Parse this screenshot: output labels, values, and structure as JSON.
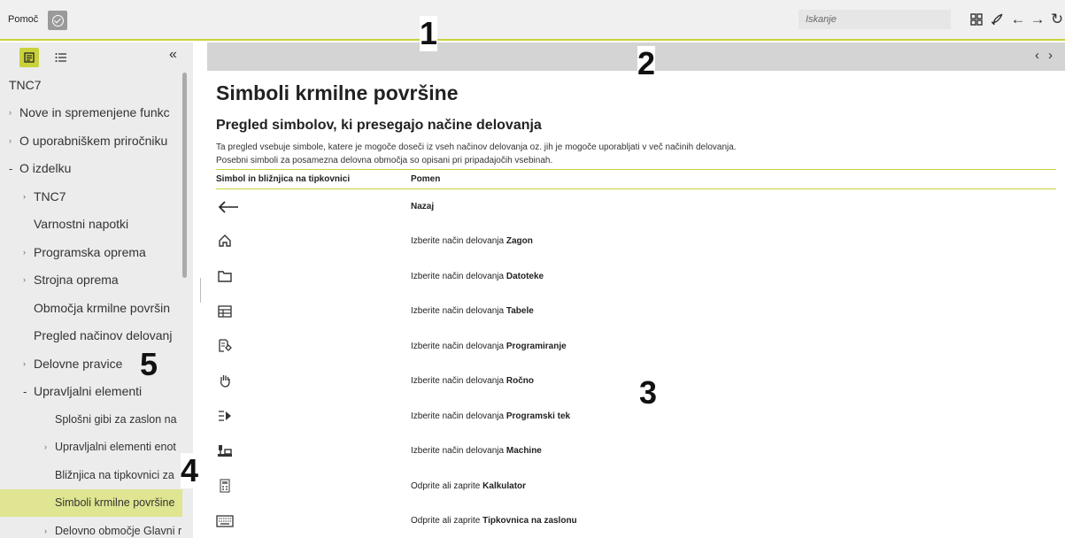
{
  "topbar": {
    "app_title": "Pomoč",
    "search_placeholder": "Iskanje"
  },
  "callouts": [
    "1",
    "2",
    "3",
    "4",
    "5"
  ],
  "sidebar": {
    "items": [
      {
        "label": "TNC7",
        "level": 0,
        "marker": ""
      },
      {
        "label": "Nove in spremenjene funkc",
        "level": 0,
        "marker": "arrow"
      },
      {
        "label": "O uporabniškem priročniku",
        "level": 0,
        "marker": "arrow"
      },
      {
        "label": "O izdelku",
        "level": 0,
        "marker": "minus"
      },
      {
        "label": "TNC7",
        "level": 1,
        "marker": "arrow"
      },
      {
        "label": "Varnostni napotki",
        "level": 1,
        "marker": ""
      },
      {
        "label": "Programska oprema",
        "level": 1,
        "marker": "arrow"
      },
      {
        "label": "Strojna oprema",
        "level": 1,
        "marker": "arrow"
      },
      {
        "label": "Območja krmilne površin",
        "level": 1,
        "marker": ""
      },
      {
        "label": "Pregled načinov delovanj",
        "level": 1,
        "marker": ""
      },
      {
        "label": "Delovne pravice",
        "level": 1,
        "marker": "arrow"
      },
      {
        "label": "Upravljalni elementi",
        "level": 1,
        "marker": "minus"
      },
      {
        "label": "Splošni gibi za zaslon na",
        "level": 2,
        "marker": ""
      },
      {
        "label": "Upravljalni elementi enot",
        "level": 2,
        "marker": "arrow"
      },
      {
        "label": "Bližnjica na tipkovnici za",
        "level": 2,
        "marker": ""
      },
      {
        "label": "Simboli krmilne površine",
        "level": 2,
        "marker": "",
        "active": true
      },
      {
        "label": "Delovno območje Glavni r",
        "level": 2,
        "marker": "arrow"
      }
    ]
  },
  "content": {
    "title": "Simboli krmilne površine",
    "subtitle": "Pregled simbolov, ki presegajo načine delovanja",
    "intro_line1": "Ta pregled vsebuje simbole, katere je mogoče doseči iz vseh načinov delovanja oz. jih je mogoče uporabljati v več načinih delovanja.",
    "intro_line2": "Posebni simboli za posamezna delovna območja so opisani pri pripadajočih vsebinah.",
    "table": {
      "headers": [
        "Simbol in bližnjica na tipkovnici",
        "Pomen"
      ],
      "rows": [
        {
          "icon": "back-arrow-icon",
          "prefix": "",
          "bold": "Nazaj"
        },
        {
          "icon": "home-icon",
          "prefix": "Izberite način delovanja ",
          "bold": "Zagon"
        },
        {
          "icon": "folder-icon",
          "prefix": "Izberite način delovanja ",
          "bold": "Datoteke"
        },
        {
          "icon": "table-icon",
          "prefix": "Izberite način delovanja ",
          "bold": "Tabele"
        },
        {
          "icon": "program-edit-icon",
          "prefix": "Izberite način delovanja ",
          "bold": "Programiranje"
        },
        {
          "icon": "hand-icon",
          "prefix": "Izberite način delovanja ",
          "bold": "Ročno"
        },
        {
          "icon": "program-run-icon",
          "prefix": "Izberite način delovanja ",
          "bold": "Programski tek"
        },
        {
          "icon": "machine-icon",
          "prefix": "Izberite način delovanja ",
          "bold": "Machine"
        },
        {
          "icon": "calculator-icon",
          "prefix": "Odprite ali zaprite ",
          "bold": "Kalkulator"
        },
        {
          "icon": "keyboard-icon",
          "prefix": "Odprite ali zaprite ",
          "bold": "Tipkovnica na zaslonu"
        }
      ]
    }
  }
}
